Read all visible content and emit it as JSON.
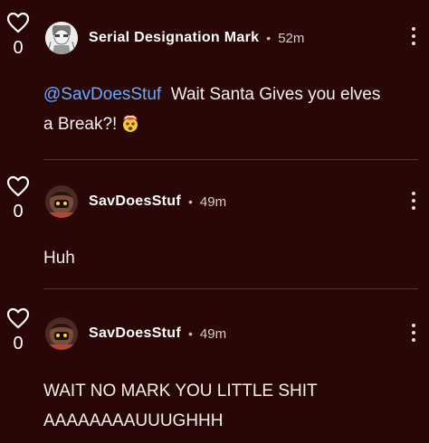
{
  "comments": [
    {
      "username": "Serial Designation Mark",
      "separator": "•",
      "time": "52m",
      "likes": "0",
      "mention": "@SavDoesStuf",
      "text": "Wait Santa Gives you elves a Break?!",
      "emoji_icon": "exploding-head-icon"
    },
    {
      "username": "SavDoesStuf",
      "separator": "•",
      "time": "49m",
      "likes": "0",
      "text": "Huh"
    },
    {
      "username": "SavDoesStuf",
      "separator": "•",
      "time": "49m",
      "likes": "0",
      "text_line1": "WAIT NO MARK YOU LITTLE SHIT",
      "text_line2": "AAAAAAAAUUUGHHH"
    }
  ],
  "colors": {
    "background": "#2a0707",
    "mention": "#6aa9ff",
    "divider": "#5a3030"
  }
}
